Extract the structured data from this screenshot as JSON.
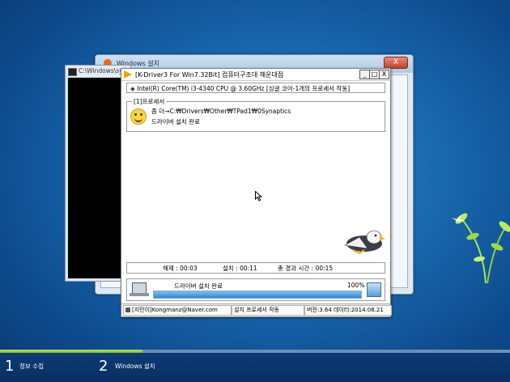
{
  "setup_window": {
    "title": "Windows 설치"
  },
  "console_window": {
    "title": "C:\\Windows\\system32\\cmd.exe"
  },
  "kdriver": {
    "title": "[K-Driver3 For Win7.32Bit] 컴퓨터구조대 해운대점",
    "buttons": {
      "minimize": "_",
      "maximize": "□",
      "close": "X"
    },
    "cpu": "◈ Intel(R) Core(TM) i3-4340 CPU @ 3.60GHz [싱글 코어-1개의 프로세서 작동]",
    "process": {
      "legend": "[1]프로세서",
      "line1": "좀 더→C:₩Drivers₩Other₩TPad1₩0Synaptics",
      "line2": "드라이버 설치 완료"
    },
    "times": {
      "uninstall": "해제 : 00:03",
      "install": "설치 : 00:11",
      "total": "총 경과 시간 : 00:15"
    },
    "status": {
      "text": "드라이버 설치 완료",
      "percent_label": "100%",
      "progress": 1.0
    },
    "statusbar": {
      "author": "[지민이]Kongmanz@Naver.com",
      "state": "설치 프로세서 작동",
      "version": "버전:3.64  데이터:2014.08.21"
    }
  },
  "setup_steps": {
    "progress": 0.28,
    "steps": [
      {
        "number": "1",
        "label": "정보 수집"
      },
      {
        "number": "2",
        "label": "Windows 설치"
      }
    ]
  },
  "colors": {
    "accent_green": "#7fbf23",
    "progress_blue": "#2f86d8",
    "desktop_blue": "#1c6db4"
  }
}
